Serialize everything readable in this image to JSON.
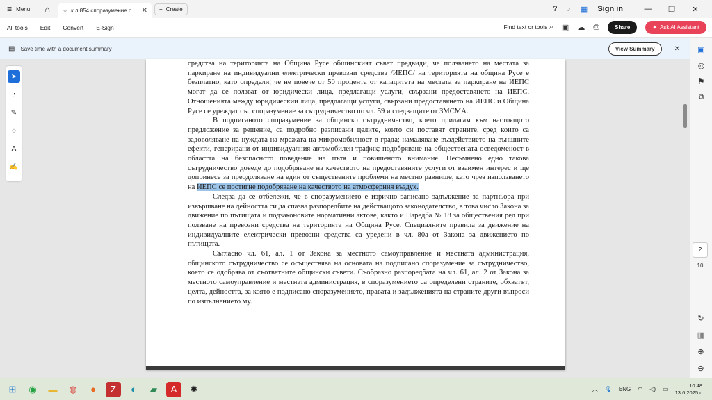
{
  "titlebar": {
    "menu_label": "Menu",
    "tab_title": "к л 854 споразумение с...",
    "create_label": "Create",
    "signin_label": "Sign in"
  },
  "toolbar": {
    "all_tools": "All tools",
    "edit": "Edit",
    "convert": "Convert",
    "esign": "E-Sign",
    "find": "Find text or tools",
    "share": "Share",
    "ask_ai": "Ask AI Assistant"
  },
  "banner": {
    "text": "Save time with a document summary",
    "button": "View Summary"
  },
  "document": {
    "p1": "средства на територията на Община Русе общинският съвет предвиди, че ползването на местата за паркиране на индивидуални електрически превозни средства /ИЕПС/ на територията на община Русе е безплатно, като определи, че не повече от 50 процента от капацитета на местата за паркиране на ИЕПС могат да се ползват от юридически лица, предлагащи услуги, свързани предоставянето на ИЕПС. Отношенията между юридическии лица, предлагащи услуги, свързани предоставянето на ИЕПС и Община Русе се уреждат със споразумение за сътрудничество по чл. 59 и следващите от ЗМСМА.",
    "p2_start": "В подписаното споразумение за общинско сътрудничество, което прилагам към настоящото предложение за решение, са подробно разписани целите, които си поставят страните, сред които са задоволяване на нуждата на мрежата на микромобилност в града; намаляване въздействието на външните ефекти, генерирани от индивидуалния автомобилен трафик; подобряване на обществената осведоменост в областта на безопасното поведение на пътя и повишеното внимание. Несъмнено едно такова сътрудничество доведе до подобряване на качеството на предоставяните услуги от взаимен интерес и ще допринесе за преодоляване на един от съществените проблеми на местно равнище, като чрез използването на ",
    "p2_highlight": "ИЕПС се постигне подобряване на качеството на атмосферния въздух.",
    "p3": "Следва да се отбележи, че в споразумението е изрично записано задължение за партньора при извършване на дейността си да спазва разпоредбите на действащото законодателство, в това число Закона за движение по пътищата и подзаконовите нормативни актове, както и Наредба № 18 за обществения ред при ползване на превозни средства на територията на Община Русе. Специалните правила за движение на индивидуалните електрически превозни средства са уредени в чл. 80а от Закона за движението по пътищата.",
    "p4": "Съгласно чл. 61, ал. 1 от Закона за местното самоуправление и местната администрация, общинското сътрудничество се осъществява на основата на подписано споразумение за сътрудничество, което се одобрява от съответните общински съвети. Съобразно разпоредбата на чл. 61, ал. 2 от Закона за местното самоуправление и местната администрация, в споразумението са определени страните, обхватът, целта, дейността, за която е подписано споразумението, правата и задълженията на страните други въпроси по изпълнението му."
  },
  "pager": {
    "current": "2",
    "total": "10"
  },
  "tray": {
    "lang": "ENG",
    "time": "10:48",
    "date": "13.6.2025 г."
  },
  "colors": {
    "accent": "#1e6fd9",
    "ai": "#e9435a",
    "highlight": "#9cc3e8"
  }
}
